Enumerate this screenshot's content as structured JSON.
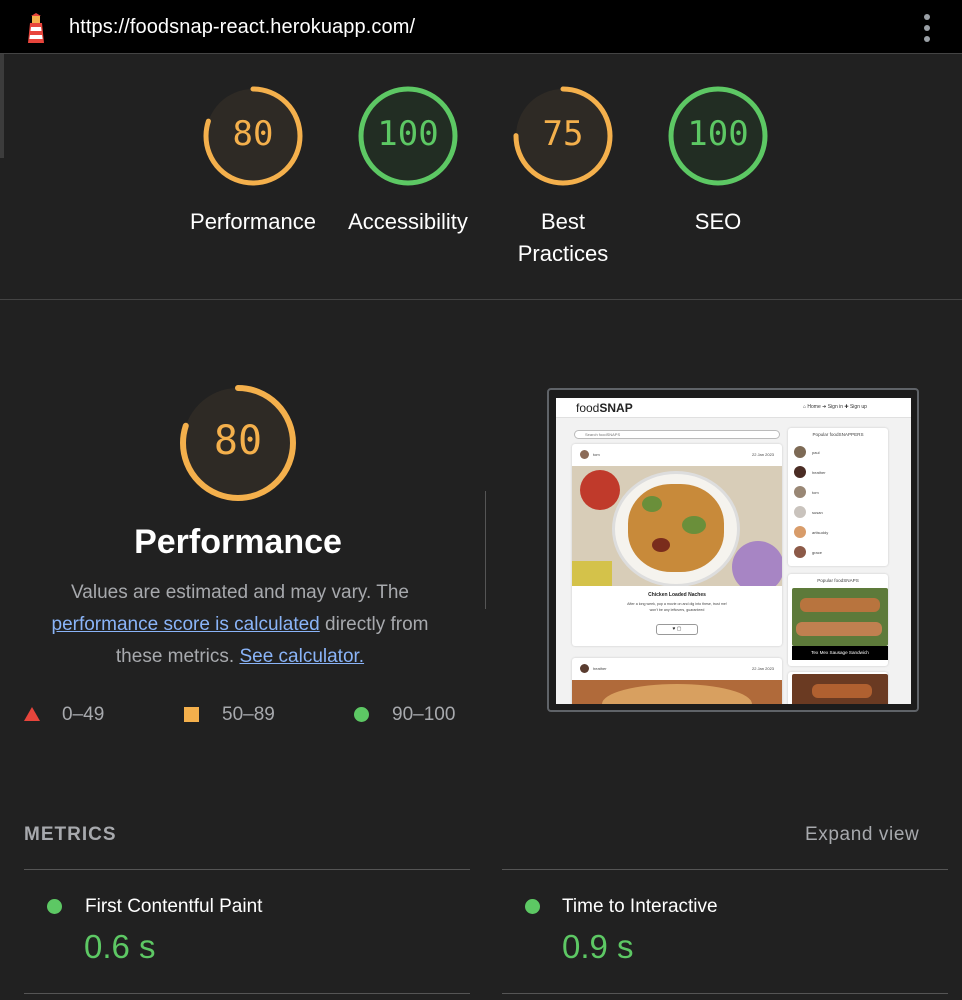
{
  "topbar": {
    "url": "https://foodsnap-react.herokuapp.com/",
    "logo_icon": "lighthouse-icon",
    "menu_icon": "kebab-menu-icon"
  },
  "gauges": [
    {
      "score": "80",
      "label": "Performance",
      "color": "#f4b04c",
      "value": 0.8
    },
    {
      "score": "100",
      "label": "Accessibility",
      "color": "#5dc864",
      "value": 1.0
    },
    {
      "score": "75",
      "label": "Best Practices",
      "color": "#f4b04c",
      "value": 0.75
    },
    {
      "score": "100",
      "label": "SEO",
      "color": "#5dc864",
      "value": 1.0
    }
  ],
  "performance": {
    "score": "80",
    "value": 0.8,
    "title": "Performance",
    "desc_part1": "Values are estimated and may vary. The ",
    "desc_link1": "performance score is calculated",
    "desc_part2": " directly from these metrics. ",
    "desc_link2": "See calculator."
  },
  "legend": [
    {
      "range": "0–49",
      "shape": "triangle",
      "color": "#e8453c"
    },
    {
      "range": "50–89",
      "shape": "square",
      "color": "#f4b04c"
    },
    {
      "range": "90–100",
      "shape": "circle",
      "color": "#5dc864"
    }
  ],
  "screenshot": {
    "logo_light": "food",
    "logo_bold": "SNAP",
    "nav": "⌂ Home   ➜ Sign in   ✚ Sign up",
    "search_placeholder": "Search foodSNAPS",
    "post1_user": "tom",
    "post1_date": "22 Jan 2023",
    "post1_title": "Chicken Loaded Naches",
    "post1_text": "After a long week, pop a movie on and dig into these, trust me!",
    "post1_text2": "won't be any leftovers, guaranteed",
    "post2_user": "heather",
    "post2_date": "22 Jan 2023",
    "popular_snappers_title": "Popular foodSNAPPERS",
    "snappers": [
      "paul",
      "heather",
      "tom",
      "susan",
      "artisuddy",
      "grace"
    ],
    "popular_snaps_title": "Popular foodSNAPS",
    "snap_caption": "Tex Mex Sausage Sandwich"
  },
  "metrics": {
    "heading": "METRICS",
    "expand_label": "Expand view",
    "items": [
      {
        "name": "First Contentful Paint",
        "value": "0.6 s",
        "color": "#5dc864"
      },
      {
        "name": "Time to Interactive",
        "value": "0.9 s",
        "color": "#5dc864"
      }
    ]
  }
}
